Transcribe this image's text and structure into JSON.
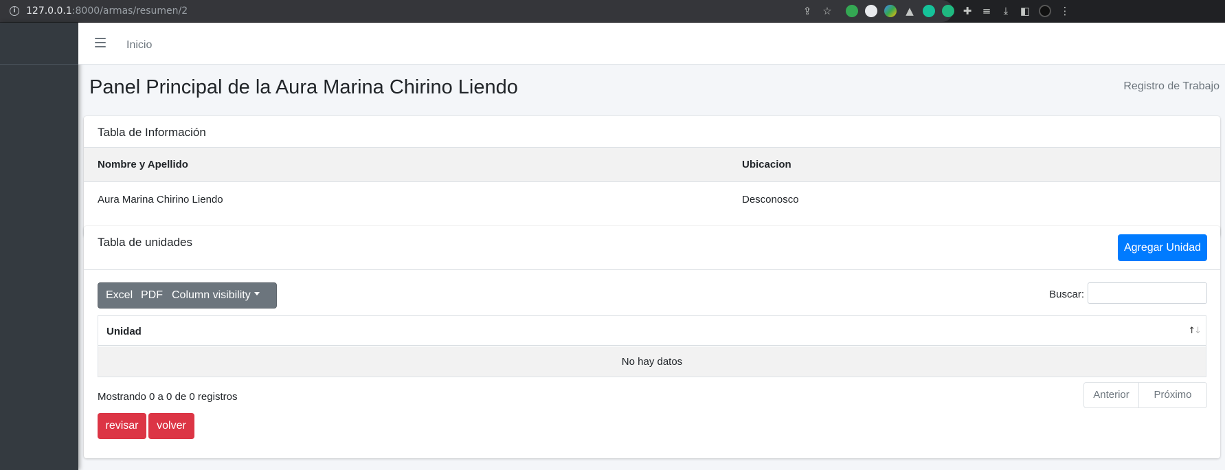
{
  "browser": {
    "url_host": "127.0.0.1",
    "url_path": ":8000/armas/resumen/2"
  },
  "nav": {
    "home_label": "Inicio"
  },
  "header": {
    "title": "Panel Principal de la Aura Marina Chirino Liendo",
    "breadcrumb": "Registro de Trabajo"
  },
  "info_table": {
    "title": "Tabla de Información",
    "columns": [
      "Nombre y Apellido",
      "Ubicacion"
    ],
    "rows": [
      [
        "Aura Marina Chirino Liendo",
        "Desconosco"
      ]
    ]
  },
  "units_table": {
    "title": "Tabla de unidades",
    "add_button": "Agregar Unidad",
    "export_buttons": [
      "Excel",
      "PDF",
      "Column visibility"
    ],
    "search_label": "Buscar:",
    "search_value": "",
    "columns": [
      "Unidad"
    ],
    "empty_text": "No hay datos",
    "info_text": "Mostrando 0 a 0 de 0 registros",
    "pager": {
      "previous": "Anterior",
      "next": "Próximo"
    },
    "actions": [
      "revisar",
      "volver"
    ]
  },
  "colors": {
    "primary": "#007bff",
    "danger": "#dc3545",
    "secondary": "#6c757d",
    "sidebar": "#343a40"
  }
}
